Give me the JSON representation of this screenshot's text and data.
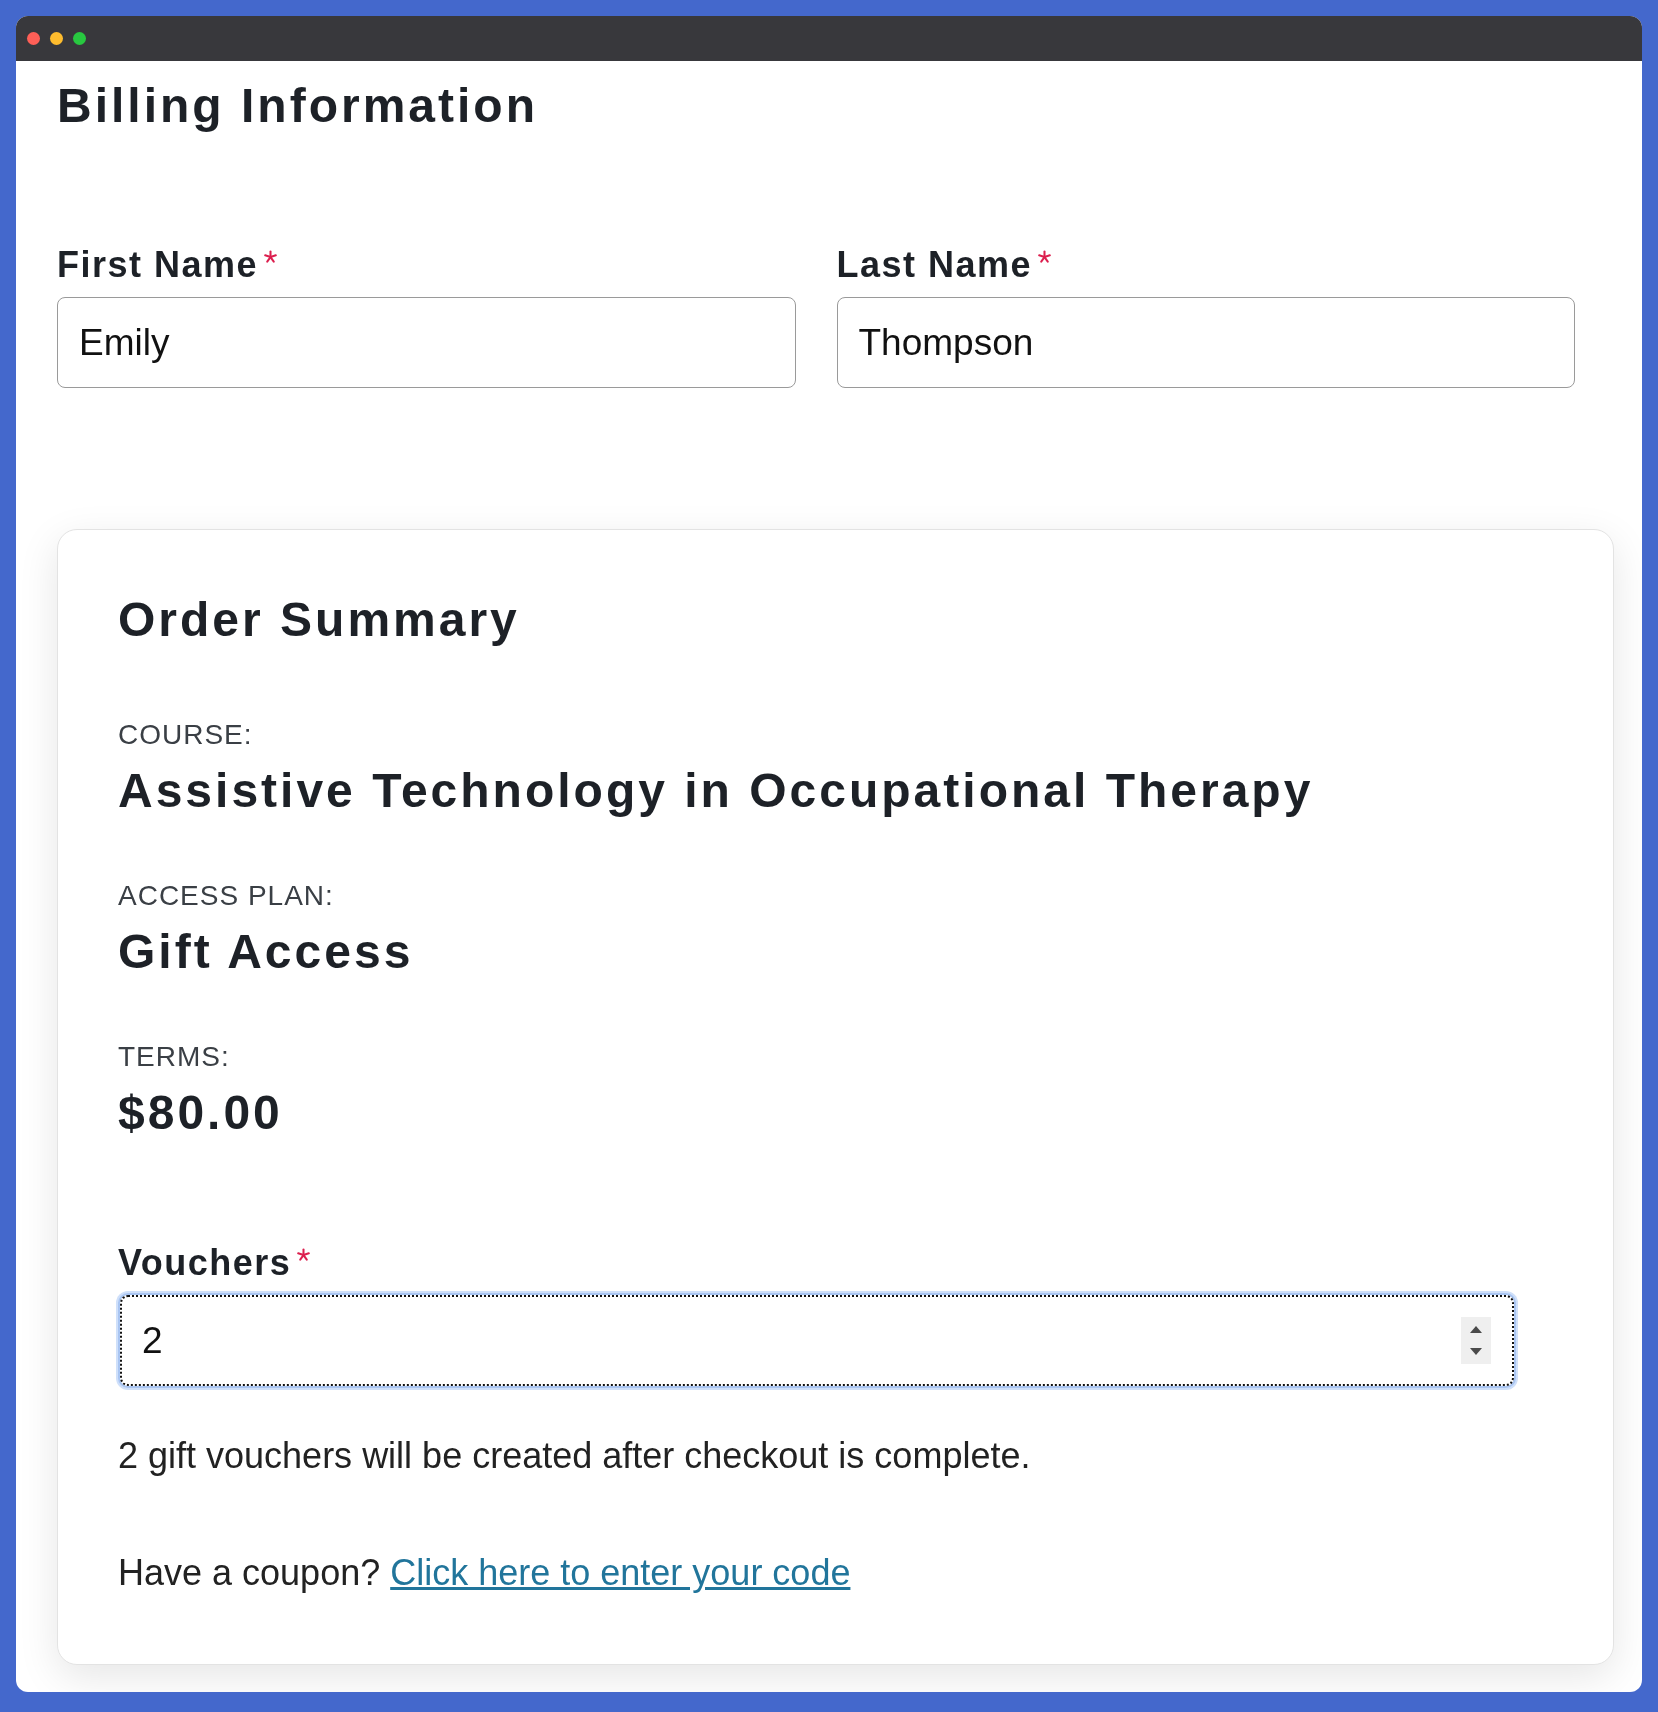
{
  "window": {
    "controls": [
      {
        "color": "#fe5f57"
      },
      {
        "color": "#febc2e"
      },
      {
        "color": "#28c840"
      }
    ]
  },
  "billing": {
    "title": "Billing Information",
    "fields": [
      {
        "label": "First Name",
        "required": true,
        "value": "Emily"
      },
      {
        "label": "Last Name",
        "required": true,
        "value": "Thompson"
      }
    ]
  },
  "order_summary": {
    "title": "Order Summary",
    "items": [
      {
        "label": "COURSE:",
        "value": "Assistive Technology in Occupational Therapy"
      },
      {
        "label": "ACCESS PLAN:",
        "value": "Gift Access"
      },
      {
        "label": "TERMS:",
        "value": "$80.00"
      }
    ],
    "vouchers": {
      "label": "Vouchers",
      "required": true,
      "value": "2",
      "focused": true
    },
    "note": "2 gift vouchers will be created after checkout is complete.",
    "coupon": {
      "prompt": "Have a coupon?",
      "link": "Click here to enter your code"
    }
  }
}
